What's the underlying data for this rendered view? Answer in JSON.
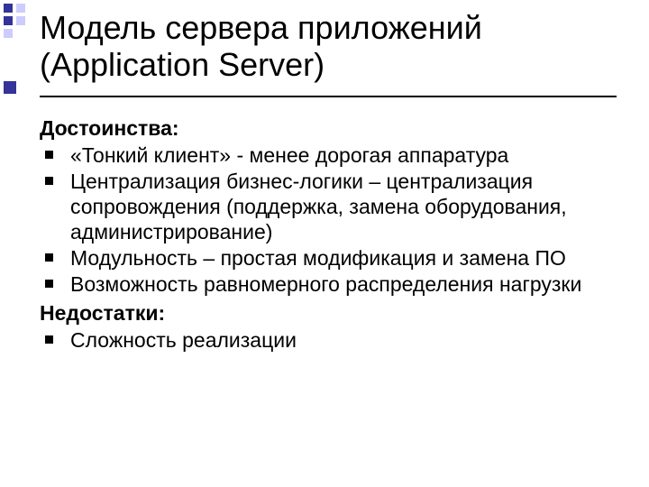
{
  "title": "Модель сервера приложений (Application Server)",
  "sections": {
    "advantages_label": "Достоинства:",
    "disadvantages_label": "Недостатки:"
  },
  "advantages": [
    "«Тонкий клиент» - менее дорогая аппаратура",
    "Централизация бизнес-логики – централизация сопровождения (поддержка, замена оборудования, администрирование)",
    "Модульность – простая модификация и замена ПО",
    "Возможность равномерного распределения нагрузки"
  ],
  "disadvantages": [
    "Сложность реализации"
  ]
}
